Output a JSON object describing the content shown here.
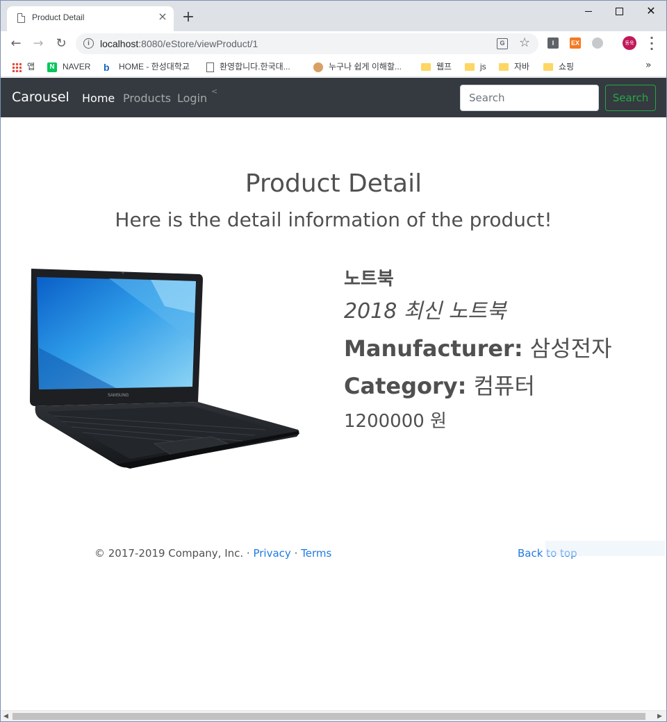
{
  "browser": {
    "tab_title": "Product Detail",
    "url_host": "localhost",
    "url_rest": ":8080/eStore/viewProduct/1",
    "profile_initials": "동욱",
    "bookmarks": [
      "앱",
      "NAVER",
      "HOME - 한성대학교",
      "환영합니다.한국대...",
      "누구나 쉽게 이해할...",
      "웹프",
      "js",
      "자바",
      "쇼핑"
    ]
  },
  "navbar": {
    "brand": "Carousel",
    "links": [
      "Home",
      "Products",
      "Login"
    ],
    "search_placeholder": "Search",
    "search_button": "Search"
  },
  "page": {
    "title": "Product Detail",
    "subtitle": "Here is the detail information of the product!"
  },
  "product": {
    "name": "노트북",
    "description": "2018 최신 노트북",
    "manufacturer_label": "Manufacturer:",
    "manufacturer": "삼성전자",
    "category_label": "Category:",
    "category": "컴퓨터",
    "price": "1200000 원",
    "brand_on_image": "SAMSUNG"
  },
  "footer": {
    "copyright": "© 2017-2019 Company, Inc. ·",
    "privacy": "Privacy",
    "separator": "·",
    "terms": "Terms",
    "back_to_top": "Back to top"
  },
  "colors": {
    "navbar_bg": "#343a40",
    "search_green": "#28a745",
    "link_blue": "#1e7be0",
    "heading_gray": "#505050"
  }
}
